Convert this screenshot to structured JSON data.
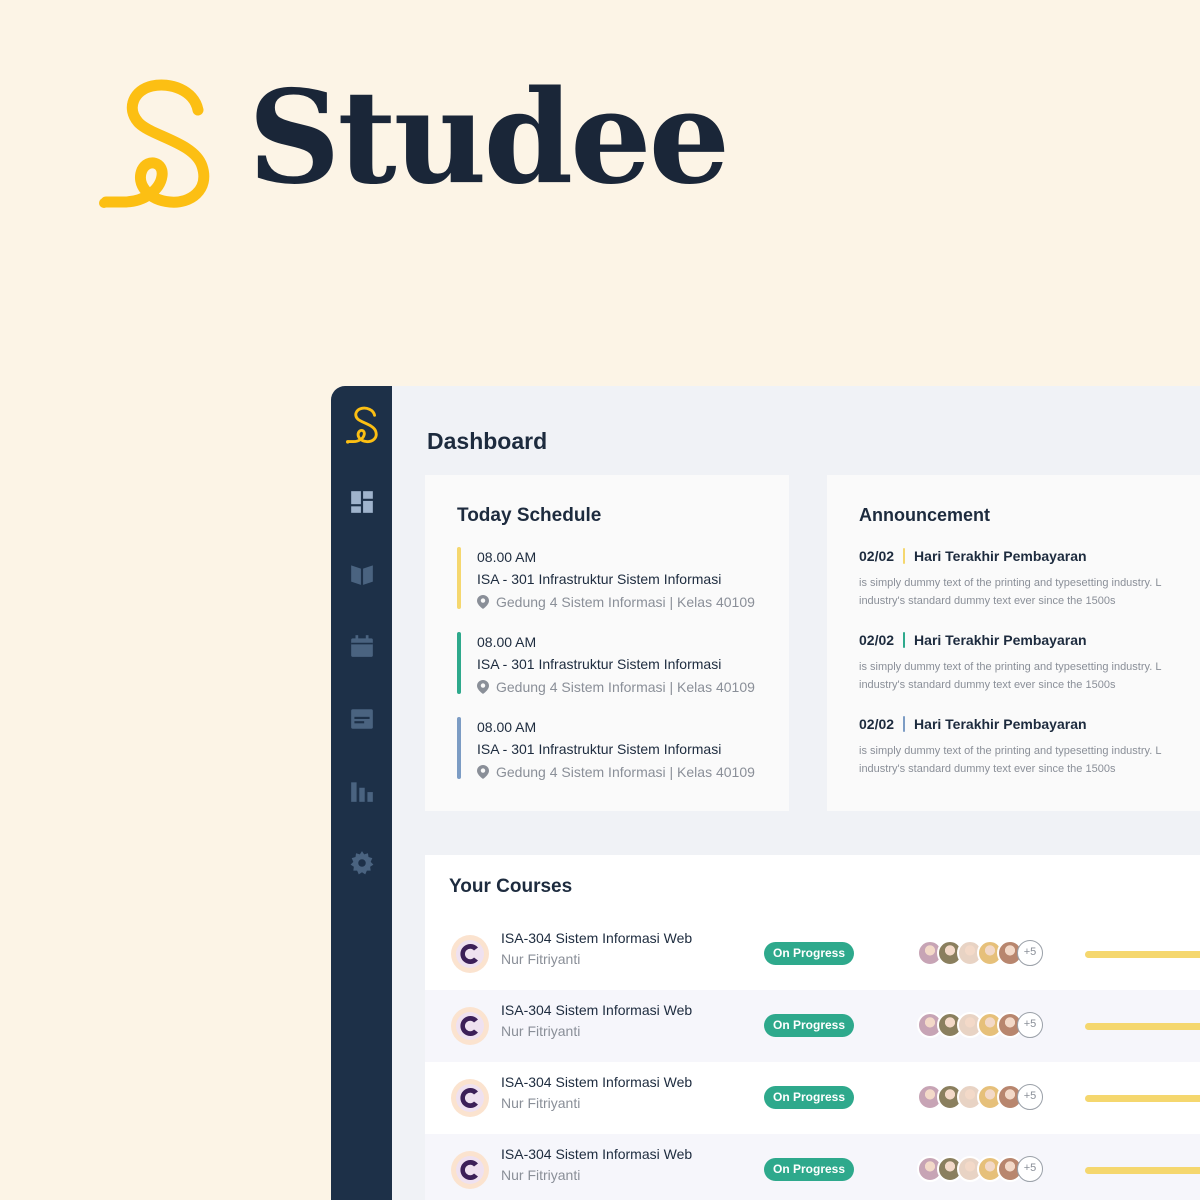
{
  "brand": {
    "name": "Studee",
    "accent": "#fcbf13"
  },
  "nav": [
    {
      "icon": "dashboard-icon"
    },
    {
      "icon": "book-icon"
    },
    {
      "icon": "calendar-icon"
    },
    {
      "icon": "document-icon"
    },
    {
      "icon": "chart-icon"
    },
    {
      "icon": "gear-icon"
    }
  ],
  "page": {
    "title": "Dashboard"
  },
  "schedule": {
    "title": "Today Schedule",
    "items": [
      {
        "time": "08.00 AM",
        "course": "ISA - 301 Infrastruktur Sistem Informasi",
        "location": "Gedung 4 Sistem Informasi | Kelas 40109",
        "color": "#f5d76e"
      },
      {
        "time": "08.00 AM",
        "course": "ISA - 301 Infrastruktur Sistem Informasi",
        "location": "Gedung 4 Sistem Informasi | Kelas 40109",
        "color": "#2ea98c"
      },
      {
        "time": "08.00 AM",
        "course": "ISA - 301 Infrastruktur Sistem Informasi",
        "location": "Gedung 4 Sistem Informasi | Kelas 40109",
        "color": "#7c9cc4"
      }
    ]
  },
  "announcement": {
    "title": "Announcement",
    "items": [
      {
        "date": "02/02",
        "headline": "Hari Terakhir Pembayaran",
        "body1": "is simply dummy text of the printing and typesetting industry. L",
        "body2": "industry's standard dummy text ever since the 1500s"
      },
      {
        "date": "02/02",
        "headline": "Hari Terakhir Pembayaran",
        "body1": "is simply dummy text of the printing and typesetting industry. L",
        "body2": "industry's standard dummy text ever since the 1500s"
      },
      {
        "date": "02/02",
        "headline": "Hari Terakhir Pembayaran",
        "body1": "is simply dummy text of the printing and typesetting industry. L",
        "body2": "industry's standard dummy text ever since the 1500s"
      }
    ]
  },
  "courses": {
    "title": "Your Courses",
    "items": [
      {
        "name": "ISA-304 Sistem Informasi Web",
        "teacher": "Nur Fitriyanti",
        "status": "On Progress",
        "more": "+5",
        "progress": 1.0
      },
      {
        "name": "ISA-304 Sistem Informasi Web",
        "teacher": "Nur Fitriyanti",
        "status": "On Progress",
        "more": "+5",
        "progress": 1.0
      },
      {
        "name": "ISA-304 Sistem Informasi Web",
        "teacher": "Nur Fitriyanti",
        "status": "On Progress",
        "more": "+5",
        "progress": 1.0
      },
      {
        "name": "ISA-304 Sistem Informasi Web",
        "teacher": "Nur Fitriyanti",
        "status": "On Progress",
        "more": "+5",
        "progress": 1.0
      }
    ]
  }
}
